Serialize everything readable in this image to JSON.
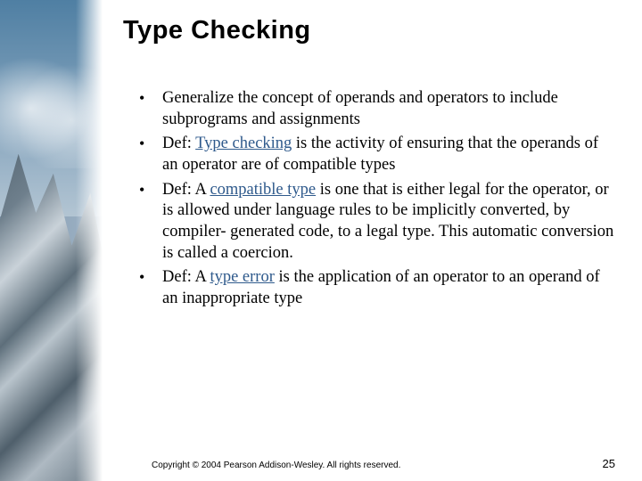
{
  "title": "Type Checking",
  "bullets": [
    {
      "pre": "Generalize the concept of operands and operators to include subprograms and assignments",
      "term": "",
      "post": ""
    },
    {
      "pre": "Def: ",
      "term": "Type checking",
      "post": " is the activity of ensuring that the operands of an operator are of compatible types"
    },
    {
      "pre": "Def: A ",
      "term": "compatible type",
      "post": " is one that is either legal for the operator, or is allowed under language rules to be implicitly converted, by compiler- generated code, to a legal type.  This automatic conversion is called a coercion."
    },
    {
      "pre": "Def: A ",
      "term": "type error",
      "post": " is the application of an operator to an operand of an inappropriate type"
    }
  ],
  "footer": {
    "copyright": "Copyright © 2004 Pearson Addison-Wesley. All rights reserved.",
    "page": "25"
  }
}
